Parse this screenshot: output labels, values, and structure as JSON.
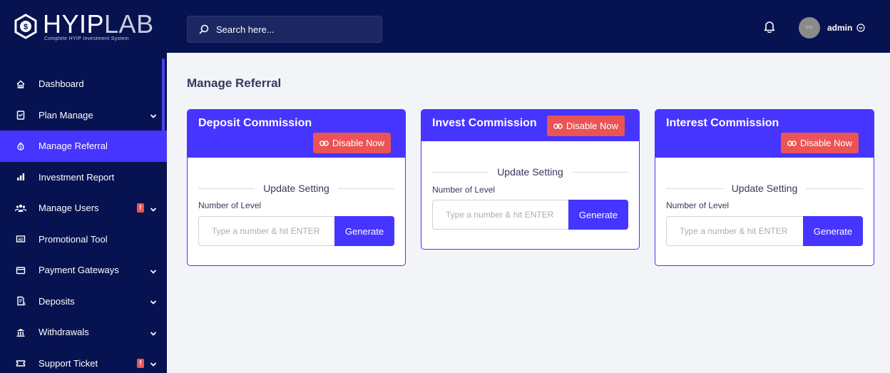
{
  "logo": {
    "main_strong": "HYIP",
    "main_light": "LAB",
    "subtitle": "Complete HYIP Investment System"
  },
  "search": {
    "placeholder": "Search here..."
  },
  "user": {
    "name": "admin",
    "avatar_initials": "PR"
  },
  "sidebar": {
    "items": [
      {
        "label": "Dashboard",
        "icon": "home-icon",
        "chevron": false,
        "badge": null,
        "active": false
      },
      {
        "label": "Plan Manage",
        "icon": "clipboard-icon",
        "chevron": true,
        "badge": null,
        "active": false
      },
      {
        "label": "Manage Referral",
        "icon": "money-bag-icon",
        "chevron": false,
        "badge": null,
        "active": true
      },
      {
        "label": "Investment Report",
        "icon": "bar-chart-icon",
        "chevron": false,
        "badge": null,
        "active": false
      },
      {
        "label": "Manage Users",
        "icon": "users-icon",
        "chevron": true,
        "badge": "!",
        "active": false
      },
      {
        "label": "Promotional Tool",
        "icon": "ad-icon",
        "chevron": false,
        "badge": null,
        "active": false
      },
      {
        "label": "Payment Gateways",
        "icon": "credit-card-icon",
        "chevron": true,
        "badge": null,
        "active": false
      },
      {
        "label": "Deposits",
        "icon": "receipt-icon",
        "chevron": true,
        "badge": null,
        "active": false
      },
      {
        "label": "Withdrawals",
        "icon": "bank-icon",
        "chevron": true,
        "badge": null,
        "active": false
      },
      {
        "label": "Support Ticket",
        "icon": "ticket-icon",
        "chevron": true,
        "badge": "!",
        "active": false
      }
    ]
  },
  "main": {
    "page_title": "Manage Referral",
    "cards": [
      {
        "title": "Deposit Commission",
        "disable_label": "Disable Now",
        "section_label": "Update Setting",
        "level_label": "Number of Level",
        "input_placeholder": "Type a number & hit ENTER",
        "generate_label": "Generate"
      },
      {
        "title": "Invest Commission",
        "disable_label": "Disable Now",
        "section_label": "Update Setting",
        "level_label": "Number of Level",
        "input_placeholder": "Type a number & hit ENTER",
        "generate_label": "Generate"
      },
      {
        "title": "Interest Commission",
        "disable_label": "Disable Now",
        "section_label": "Update Setting",
        "level_label": "Number of Level",
        "input_placeholder": "Type a number & hit ENTER",
        "generate_label": "Generate"
      }
    ]
  },
  "colors": {
    "sidebar_bg": "#071251",
    "primary": "#4634ff",
    "danger": "#ea5455",
    "page_bg": "#f3f4f8"
  }
}
